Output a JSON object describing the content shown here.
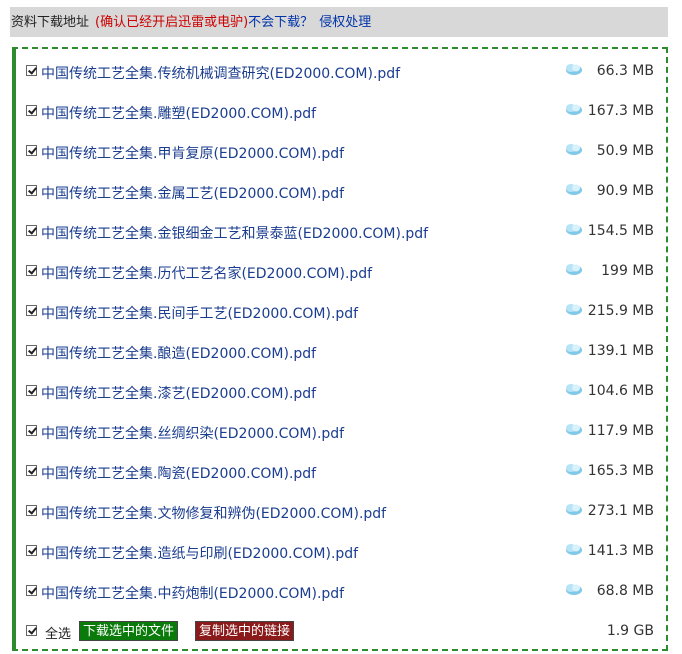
{
  "header": {
    "title": "资料下载地址",
    "warning": "(确认已经开启迅雷或电驴)",
    "help_link": "不会下载？",
    "report_link": "侵权处理"
  },
  "files": [
    {
      "name": "中国传统工艺全集.传统机械调查研究(ED2000.COM).pdf",
      "size": "66.3 MB",
      "checked": true
    },
    {
      "name": "中国传统工艺全集.雕塑(ED2000.COM).pdf",
      "size": "167.3 MB",
      "checked": true
    },
    {
      "name": "中国传统工艺全集.甲肯复原(ED2000.COM).pdf",
      "size": "50.9 MB",
      "checked": true
    },
    {
      "name": "中国传统工艺全集.金属工艺(ED2000.COM).pdf",
      "size": "90.9 MB",
      "checked": true
    },
    {
      "name": "中国传统工艺全集.金银细金工艺和景泰蓝(ED2000.COM).pdf",
      "size": "154.5 MB",
      "checked": true
    },
    {
      "name": "中国传统工艺全集.历代工艺名家(ED2000.COM).pdf",
      "size": "199 MB",
      "checked": true
    },
    {
      "name": "中国传统工艺全集.民间手工艺(ED2000.COM).pdf",
      "size": "215.9 MB",
      "checked": true
    },
    {
      "name": "中国传统工艺全集.酿造(ED2000.COM).pdf",
      "size": "139.1 MB",
      "checked": true
    },
    {
      "name": "中国传统工艺全集.漆艺(ED2000.COM).pdf",
      "size": "104.6 MB",
      "checked": true
    },
    {
      "name": "中国传统工艺全集.丝绸织染(ED2000.COM).pdf",
      "size": "117.9 MB",
      "checked": true
    },
    {
      "name": "中国传统工艺全集.陶瓷(ED2000.COM).pdf",
      "size": "165.3 MB",
      "checked": true
    },
    {
      "name": "中国传统工艺全集.文物修复和辨伪(ED2000.COM).pdf",
      "size": "273.1 MB",
      "checked": true
    },
    {
      "name": "中国传统工艺全集.造纸与印刷(ED2000.COM).pdf",
      "size": "141.3 MB",
      "checked": true
    },
    {
      "name": "中国传统工艺全集.中药炮制(ED2000.COM).pdf",
      "size": "68.8 MB",
      "checked": true
    }
  ],
  "footer": {
    "select_all_label": "全选",
    "download_button": "下载选中的文件",
    "copy_button": "复制选中的链接",
    "total_size": "1.9 GB"
  },
  "colors": {
    "border": "#2e8b2e",
    "file_link": "#1a3d8f",
    "download_button": "#0a7a0a",
    "copy_button": "#8b1a1a",
    "warning_text": "#cc0000"
  }
}
